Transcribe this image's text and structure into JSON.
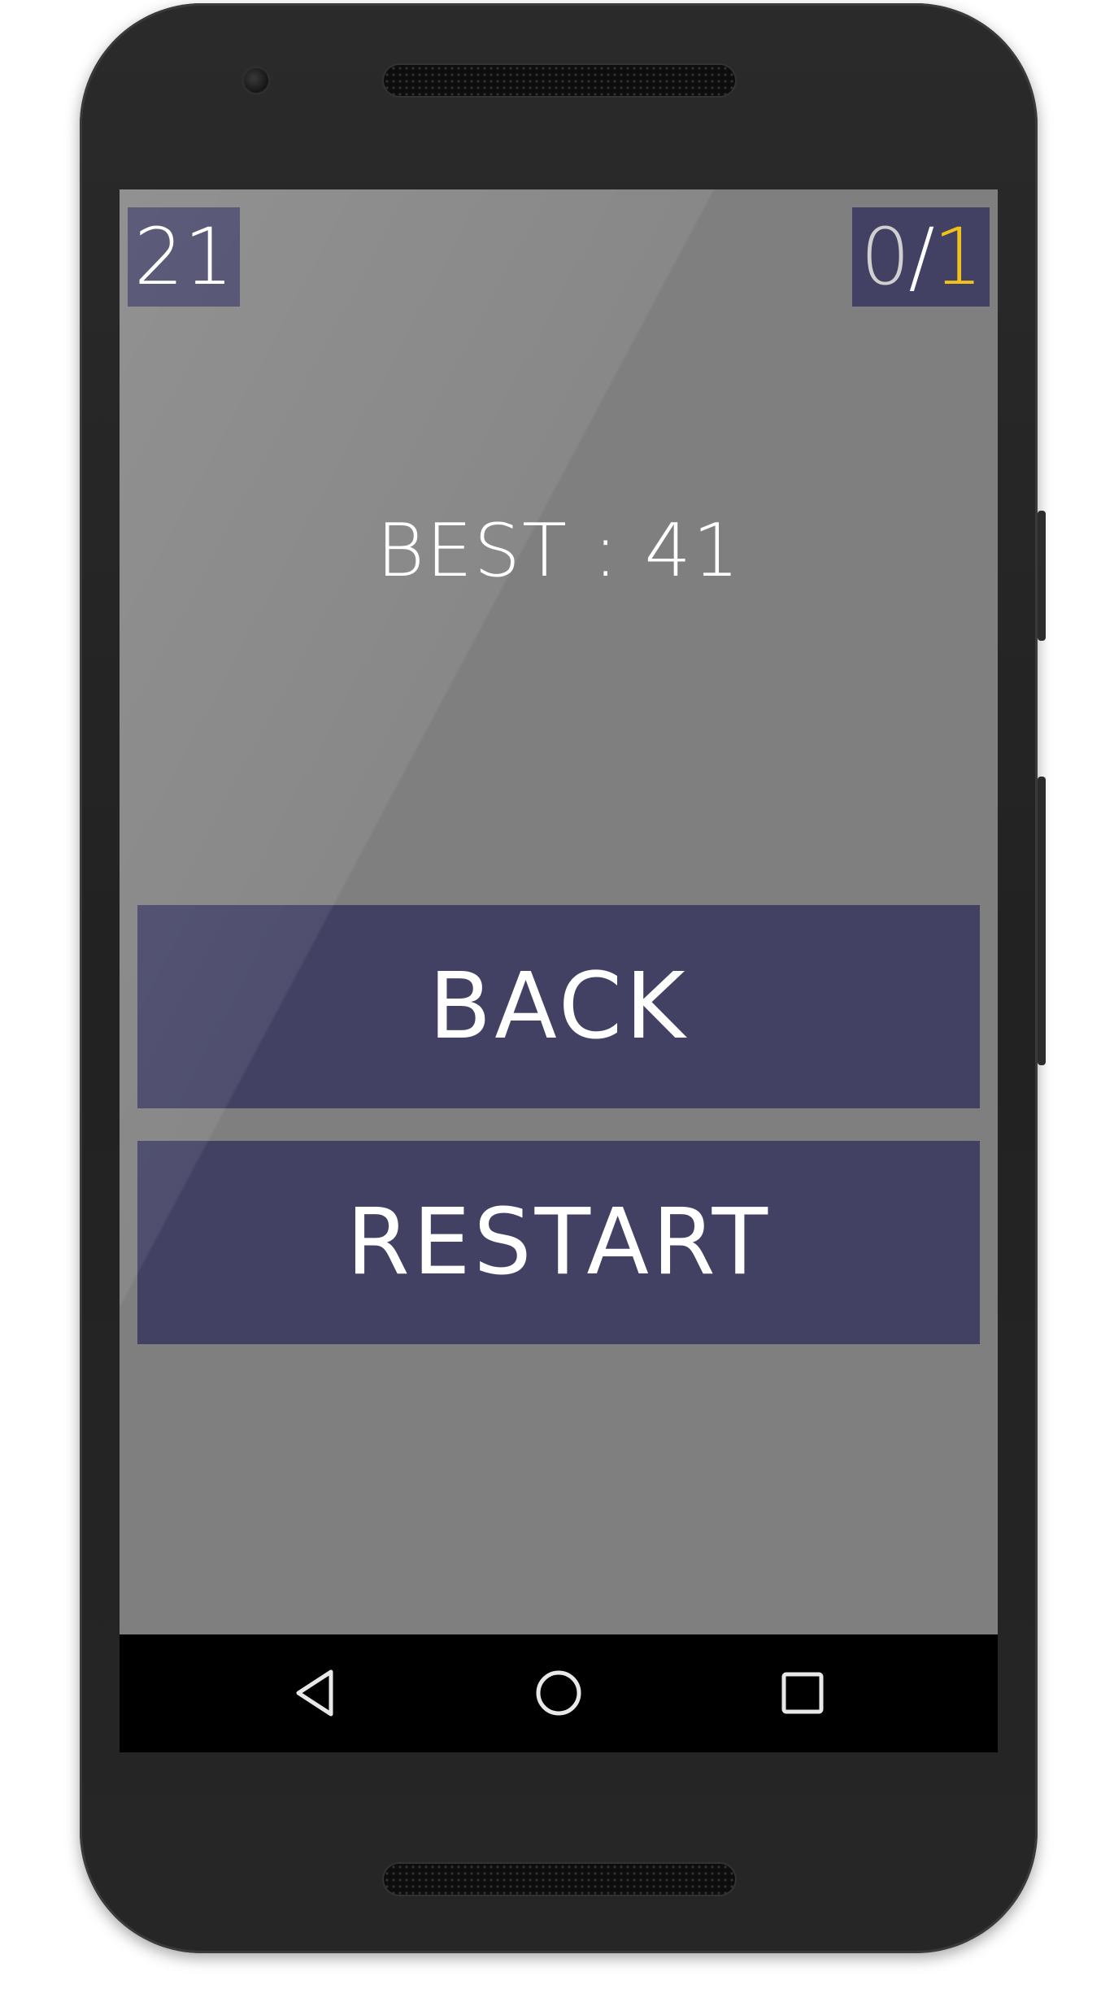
{
  "game": {
    "score": "21",
    "progress": {
      "current": "0",
      "separator": "/",
      "total": "1"
    },
    "best_text": "BEST : 41"
  },
  "buttons": {
    "back_label": "BACK",
    "restart_label": "RESTART"
  },
  "navigation": {
    "icons": [
      "back-icon",
      "home-icon",
      "recents-icon"
    ]
  },
  "colors": {
    "screen_background": "#7f7f7f",
    "panel": "#424164",
    "text": "#ffffff",
    "progress_total": "#f2c21b",
    "progress_current": "#cfcfcf",
    "navbar": "#000000"
  }
}
